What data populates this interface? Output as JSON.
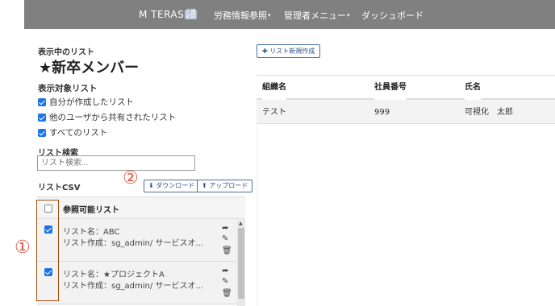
{
  "navbar": {
    "brand": "M TERAS",
    "brand_badge": "介護記録",
    "items": [
      {
        "label": "労務情報参照",
        "caret": "▾"
      },
      {
        "label": "管理者メニュー",
        "caret": "▾"
      },
      {
        "label": "ダッシュボード",
        "caret": ""
      }
    ]
  },
  "sidebar": {
    "current_list_label": "表示中のリスト",
    "current_list_title": "★新卒メンバー",
    "target_list_label": "表示対象リスト",
    "filters": [
      {
        "label": "自分が作成したリスト",
        "checked": true
      },
      {
        "label": "他のユーザから共有されたリスト",
        "checked": true
      },
      {
        "label": "すべてのリスト",
        "checked": true
      }
    ],
    "search_label": "リスト検索",
    "search_placeholder": "リスト検索...",
    "csv_label": "リストCSV",
    "download_label": "ダウンロード",
    "upload_label": "アップロード",
    "list_header": "参照可能リスト",
    "lists": [
      {
        "name": "リスト名：ABC",
        "creator": "リスト作成：sg_admin/ サービスオ...",
        "checked": true
      },
      {
        "name": "リスト名：★プロジェクトA",
        "creator": "リスト作成：sg_admin/ サービスオ...",
        "checked": true
      }
    ]
  },
  "annotations": {
    "one": "①",
    "two": "②"
  },
  "main": {
    "new_list_button": "リスト新規作成",
    "columns": [
      "組織名",
      "社員番号",
      "氏名"
    ],
    "rows": [
      [
        "テスト",
        "999",
        "可視化　太郎"
      ]
    ]
  },
  "colors": {
    "navbar": "#808080",
    "accent": "#1a73e8",
    "annotation": "#e05a4a"
  }
}
